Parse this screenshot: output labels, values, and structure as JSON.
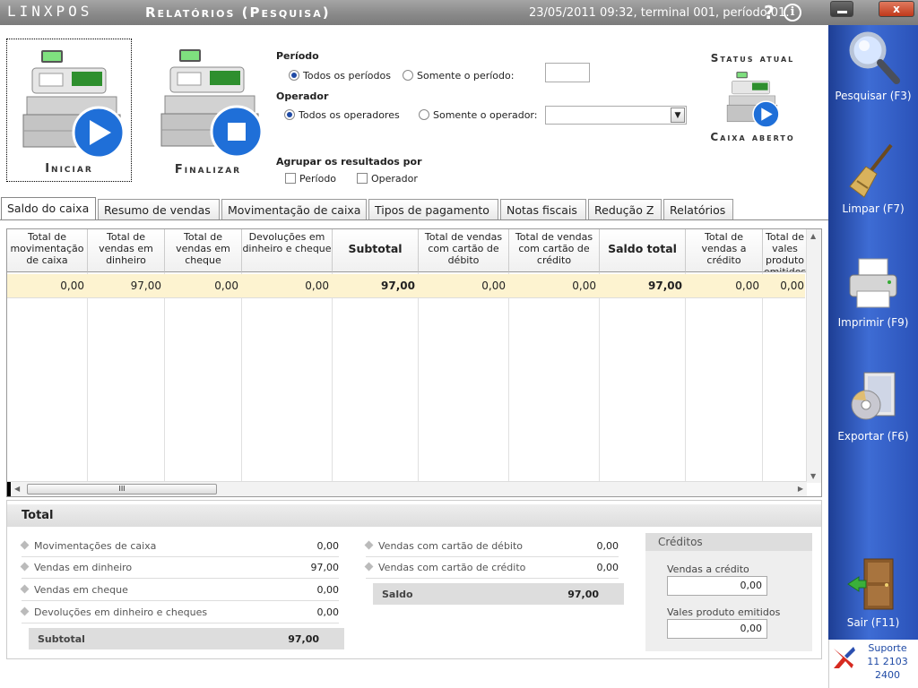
{
  "titlebar": {
    "logo": "LINXPOS",
    "title": "Relatórios (Pesquisa)",
    "status": "23/05/2011 09:32, terminal 001, período 01.",
    "help": "?",
    "info": "i",
    "close": "x"
  },
  "actions": {
    "iniciar": "Iniciar",
    "finalizar": "Finalizar"
  },
  "filters": {
    "periodo_label": "Período",
    "periodo_opt1": "Todos os períodos",
    "periodo_opt2": "Somente o período:",
    "operador_label": "Operador",
    "operador_opt1": "Todos os operadores",
    "operador_opt2": "Somente o operador:",
    "agrupar_label": "Agrupar os resultados por",
    "agrupar_opt1": "Período",
    "agrupar_opt2": "Operador"
  },
  "status_atual": {
    "title": "Status atual",
    "value": "Caixa aberto"
  },
  "tabs": [
    "Saldo do caixa",
    "Resumo de vendas",
    "Movimentação de caixa",
    "Tipos de pagamento",
    "Notas fiscais",
    "Redução Z",
    "Relatórios"
  ],
  "grid": {
    "headers": [
      "Total de movimentação de caixa",
      "Total de vendas em dinheiro",
      "Total de vendas em cheque",
      "Devoluções em dinheiro e cheque",
      "Subtotal",
      "Total de vendas com cartão de débito",
      "Total de vendas com cartão de crédito",
      "Saldo total",
      "Total de vendas a crédito",
      "Total de vales produto emitidos"
    ],
    "row": [
      "0,00",
      "97,00",
      "0,00",
      "0,00",
      "97,00",
      "0,00",
      "0,00",
      "97,00",
      "0,00",
      "0,00"
    ],
    "scroll_grip": "III"
  },
  "total": {
    "title": "Total",
    "left": [
      {
        "label": "Movimentações de caixa",
        "value": "0,00"
      },
      {
        "label": "Vendas em dinheiro",
        "value": "97,00"
      },
      {
        "label": "Vendas em cheque",
        "value": "0,00"
      },
      {
        "label": "Devoluções em dinheiro e cheques",
        "value": "0,00"
      }
    ],
    "subtotal_label": "Subtotal",
    "subtotal_value": "97,00",
    "mid": [
      {
        "label": "Vendas com cartão de débito",
        "value": "0,00"
      },
      {
        "label": "Vendas com cartão de crédito",
        "value": "0,00"
      }
    ],
    "saldo_label": "Saldo",
    "saldo_value": "97,00",
    "creditos": {
      "title": "Créditos",
      "vendas_label": "Vendas a crédito",
      "vendas_value": "0,00",
      "vales_label": "Vales produto emitidos",
      "vales_value": "0,00"
    }
  },
  "sidebar": {
    "pesquisar": "Pesquisar (F3)",
    "limpar": "Limpar (F7)",
    "imprimir": "Imprimir (F9)",
    "exportar": "Exportar (F6)",
    "sair": "Sair (F11)"
  },
  "support": {
    "label": "Suporte",
    "phone": "11 2103 2400"
  }
}
